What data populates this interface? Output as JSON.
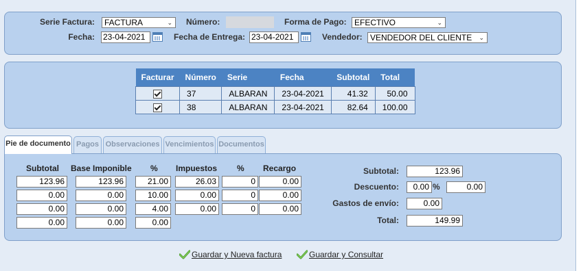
{
  "header": {
    "serie_label": "Serie Factura:",
    "serie_value": "FACTURA",
    "numero_label": "Número:",
    "forma_pago_label": "Forma de Pago:",
    "forma_pago_value": "EFECTIVO",
    "fecha_label": "Fecha:",
    "fecha_value": "23-04-2021",
    "fecha_entrega_label": "Fecha de Entrega:",
    "fecha_entrega_value": "23-04-2021",
    "vendedor_label": "Vendedor:",
    "vendedor_value": "VENDEDOR DEL CLIENTE"
  },
  "albaranes": {
    "columns": [
      "Facturar",
      "Número",
      "Serie",
      "Fecha",
      "Subtotal",
      "Total"
    ],
    "rows": [
      {
        "numero": "37",
        "serie": "ALBARAN",
        "fecha": "23-04-2021",
        "subtotal": "41.32",
        "total": "50.00"
      },
      {
        "numero": "38",
        "serie": "ALBARAN",
        "fecha": "23-04-2021",
        "subtotal": "82.64",
        "total": "100.00"
      }
    ]
  },
  "tabs": [
    "Pie de documento",
    "Pagos",
    "Observaciones",
    "Vencimientos",
    "Documentos"
  ],
  "pie": {
    "columns": [
      "Subtotal",
      "Base Imponible",
      "%",
      "Impuestos",
      "%",
      "Recargo"
    ],
    "rows": [
      [
        "123.96",
        "123.96",
        "21.00",
        "26.03",
        "0",
        "0.00"
      ],
      [
        "0.00",
        "0.00",
        "10.00",
        "0.00",
        "0",
        "0.00"
      ],
      [
        "0.00",
        "0.00",
        "4.00",
        "0.00",
        "0",
        "0.00"
      ],
      [
        "0.00",
        "0.00",
        "0.00"
      ]
    ],
    "totals": {
      "subtotal_label": "Subtotal:",
      "subtotal_value": "123.96",
      "descuento_label": "Descuento:",
      "descuento_pct": "0.00",
      "pct_sign": "%",
      "descuento_value": "0.00",
      "gastos_label": "Gastos de envío:",
      "gastos_value": "0.00",
      "total_label": "Total:",
      "total_value": "149.99"
    }
  },
  "actions": {
    "save_new": "Guardar y Nueva factura",
    "save_view": "Guardar y Consultar"
  }
}
